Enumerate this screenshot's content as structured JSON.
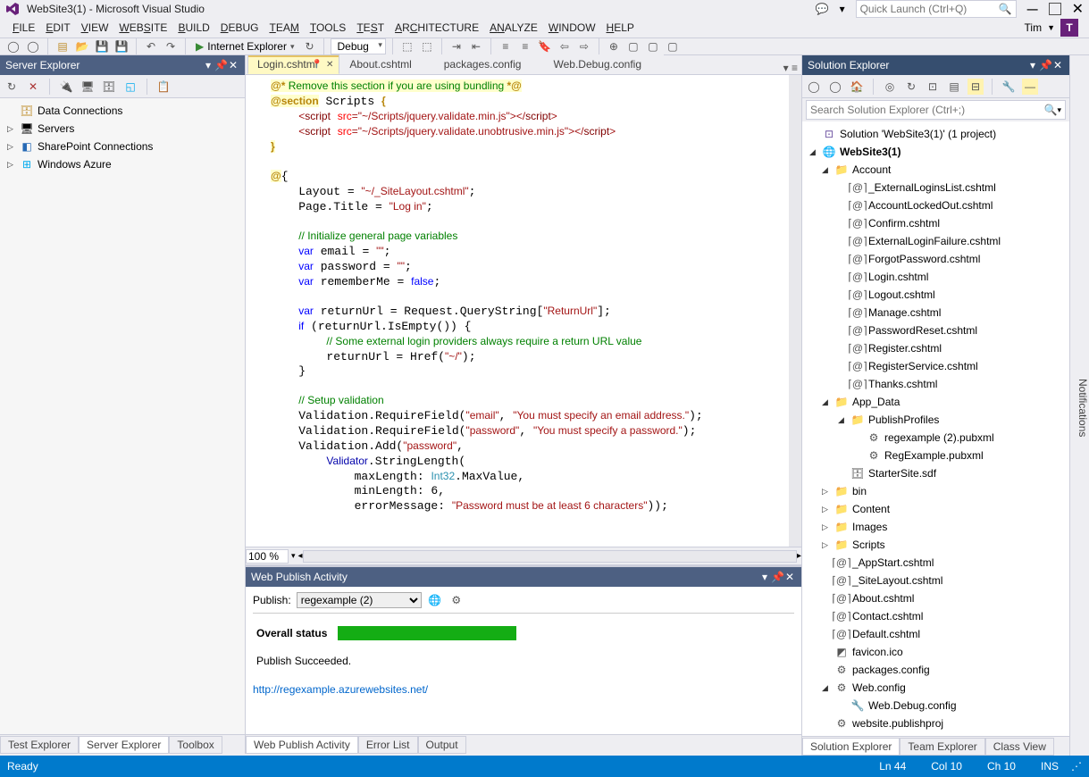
{
  "titlebar": {
    "app_title": "WebSite3(1) - Microsoft Visual Studio",
    "quick_launch_placeholder": "Quick Launch (Ctrl+Q)"
  },
  "menu": [
    "FILE",
    "EDIT",
    "VIEW",
    "WEBSITE",
    "BUILD",
    "DEBUG",
    "TEAM",
    "TOOLS",
    "TEST",
    "ARCHITECTURE",
    "ANALYZE",
    "WINDOW",
    "HELP"
  ],
  "user": {
    "name": "Tim",
    "initial": "T"
  },
  "toolbar": {
    "run_target": "Internet Explorer",
    "config": "Debug"
  },
  "left_panel": {
    "title": "Server Explorer",
    "items": [
      {
        "label": "Data Connections",
        "icon": "db"
      },
      {
        "label": "Servers",
        "icon": "server",
        "expand": true
      },
      {
        "label": "SharePoint Connections",
        "icon": "sp",
        "expand": true
      },
      {
        "label": "Windows Azure",
        "icon": "azure",
        "expand": true
      }
    ]
  },
  "editor": {
    "tabs": [
      "Login.cshtml",
      "About.cshtml",
      "packages.config",
      "Web.Debug.config"
    ],
    "active_tab": 0,
    "zoom": "100 %"
  },
  "bottom": {
    "title": "Web Publish Activity",
    "publish_label": "Publish:",
    "profile": "regexample (2)",
    "overall_label": "Overall status",
    "succeeded": "Publish Succeeded.",
    "url": "http://regexample.azurewebsites.net/"
  },
  "left_tabs": [
    "Test Explorer",
    "Server Explorer",
    "Toolbox"
  ],
  "left_tabs_active": 1,
  "center_tabs": [
    "Web Publish Activity",
    "Error List",
    "Output"
  ],
  "center_tabs_active": 0,
  "right_panel": {
    "title": "Solution Explorer",
    "search_placeholder": "Search Solution Explorer (Ctrl+;)",
    "solution": "Solution 'WebSite3(1)' (1 project)",
    "project": "WebSite3(1)",
    "account_folder": "Account",
    "account_files": [
      "_ExternalLoginsList.cshtml",
      "AccountLockedOut.cshtml",
      "Confirm.cshtml",
      "ExternalLoginFailure.cshtml",
      "ForgotPassword.cshtml",
      "Login.cshtml",
      "Logout.cshtml",
      "Manage.cshtml",
      "PasswordReset.cshtml",
      "Register.cshtml",
      "RegisterService.cshtml",
      "Thanks.cshtml"
    ],
    "appdata_folder": "App_Data",
    "publish_folder": "PublishProfiles",
    "publish_files": [
      "regexample (2).pubxml",
      "RegExample.pubxml"
    ],
    "starter_db": "StarterSite.sdf",
    "folders2": [
      "bin",
      "Content",
      "Images",
      "Scripts"
    ],
    "root_files": [
      "_AppStart.cshtml",
      "_SiteLayout.cshtml",
      "About.cshtml",
      "Contact.cshtml",
      "Default.cshtml",
      "favicon.ico",
      "packages.config"
    ],
    "webconfig": "Web.config",
    "webdebug": "Web.Debug.config",
    "publishproj": "website.publishproj"
  },
  "right_tabs": [
    "Solution Explorer",
    "Team Explorer",
    "Class View"
  ],
  "right_tabs_active": 0,
  "right_strip": "Notifications",
  "statusbar": {
    "ready": "Ready",
    "ln": "Ln 44",
    "col": "Col 10",
    "ch": "Ch 10",
    "ins": "INS"
  }
}
